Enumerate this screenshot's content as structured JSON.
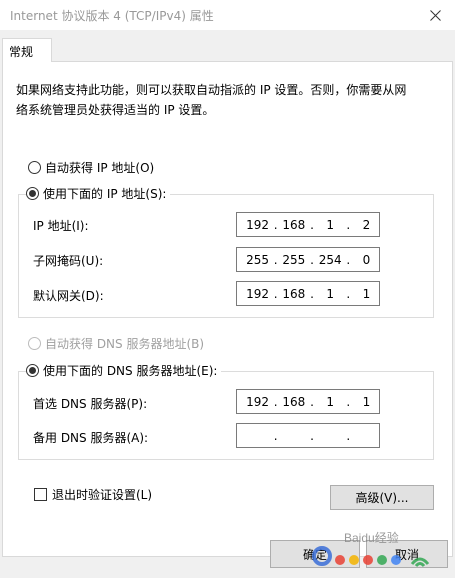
{
  "window": {
    "title": "Internet 协议版本 4 (TCP/IPv4) 属性",
    "close_glyph": "✕"
  },
  "tabs": [
    {
      "label": "常规"
    }
  ],
  "description": {
    "line1": "如果网络支持此功能，则可以获取自动指派的 IP 设置。否则，你需要从网",
    "line2": "络系统管理员处获得适当的 IP 设置。"
  },
  "ip_section": {
    "auto_label": "自动获得 IP 地址(O)",
    "manual_label": "使用下面的 IP 地址(S):",
    "selected": "manual",
    "fields": [
      {
        "label": "IP 地址(I):",
        "octets": [
          "192",
          "168",
          "1",
          "2"
        ]
      },
      {
        "label": "子网掩码(U):",
        "octets": [
          "255",
          "255",
          "254",
          "0"
        ]
      },
      {
        "label": "默认网关(D):",
        "octets": [
          "192",
          "168",
          "1",
          "1"
        ]
      }
    ]
  },
  "dns_section": {
    "auto_label": "自动获得 DNS 服务器地址(B)",
    "auto_disabled": true,
    "manual_label": "使用下面的 DNS 服务器地址(E):",
    "selected": "manual",
    "fields": [
      {
        "label": "首选 DNS 服务器(P):",
        "octets": [
          "192",
          "168",
          "1",
          "1"
        ]
      },
      {
        "label": "备用 DNS 服务器(A):",
        "octets": [
          "",
          "",
          "",
          ""
        ]
      }
    ]
  },
  "validate_checkbox": {
    "label": "退出时验证设置(L)",
    "checked": false
  },
  "buttons": {
    "advanced": "高级(V)...",
    "ok": "确定",
    "cancel": "取消"
  },
  "watermark": {
    "text": "Baidu经验"
  }
}
